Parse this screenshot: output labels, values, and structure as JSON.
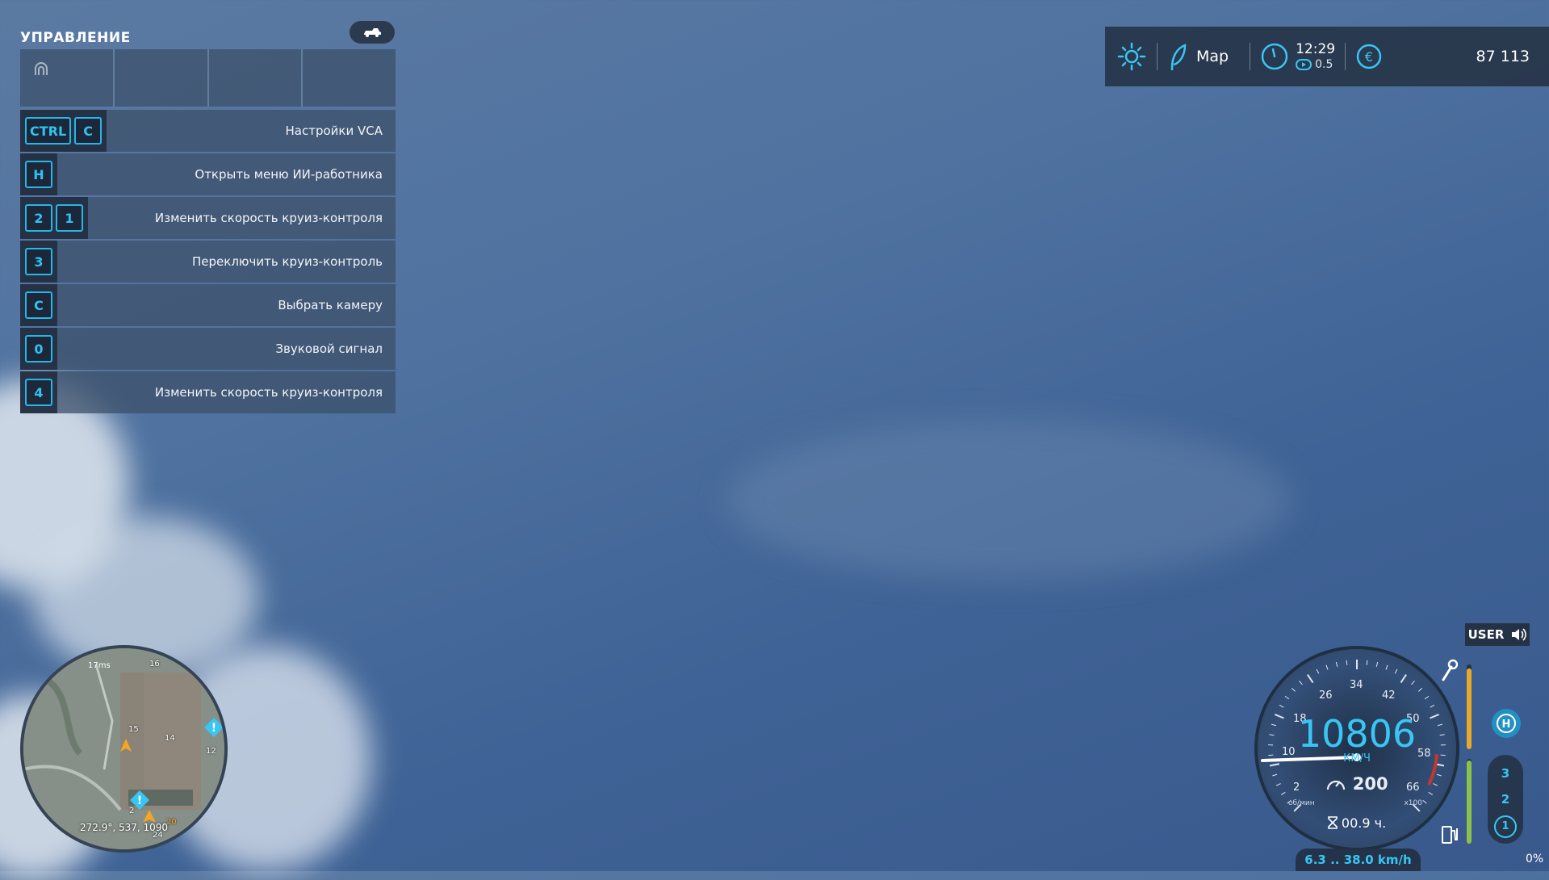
{
  "controls_panel": {
    "title": "УПРАВЛЕНИЕ",
    "rows": [
      {
        "keys": [
          "CTRL",
          "C"
        ],
        "label": "Настройки VCA"
      },
      {
        "keys": [
          "H"
        ],
        "label": "Открыть меню ИИ-работника"
      },
      {
        "keys": [
          "2",
          "1"
        ],
        "label": "Изменить скорость круиз-контроля"
      },
      {
        "keys": [
          "3"
        ],
        "label": "Переключить круиз-контроль"
      },
      {
        "keys": [
          "C"
        ],
        "label": "Выбрать камеру"
      },
      {
        "keys": [
          "0"
        ],
        "label": "Звуковой сигнал"
      },
      {
        "keys": [
          "4"
        ],
        "label": "Изменить скорость круиз-контроля"
      }
    ]
  },
  "top_bar": {
    "map_label": "Map",
    "time": "12:29",
    "time_speed": "0.5",
    "money": "87 113"
  },
  "minimap": {
    "ping": "17ms",
    "coords": "272.9°, 537, 1090",
    "field_numbers": [
      "16",
      "15",
      "14",
      "12",
      "20",
      "24",
      "2"
    ]
  },
  "dashboard": {
    "audio_mode": "USER",
    "speed": "10806",
    "speed_unit": "КМ/Ч",
    "cruise_speed": "200",
    "operating_hours": "00.9 ч.",
    "rpm_unit": "об/мин",
    "rpm_multiplier": "x100",
    "tick_labels": [
      "2",
      "10",
      "18",
      "26",
      "34",
      "42",
      "50",
      "58",
      "66"
    ],
    "gears": [
      "3",
      "2",
      "1"
    ],
    "range": "6.3 .. 38.0 km/h",
    "fuel_percent": "0%",
    "damage_level": 0.95,
    "fuel_level": 0.98
  },
  "colors": {
    "accent": "#39c6f4",
    "panel": "#3c5069",
    "damage_bar": "#e9a928",
    "fuel_bar": "#8bc34a"
  },
  "icons": [
    "weather-sun-icon",
    "map-leaf-icon",
    "clock-icon",
    "euro-icon",
    "vehicle-icon",
    "ai-worker-icon",
    "speaker-icon",
    "wrench-icon",
    "fuel-icon",
    "cruise-icon",
    "hourglass-icon"
  ]
}
